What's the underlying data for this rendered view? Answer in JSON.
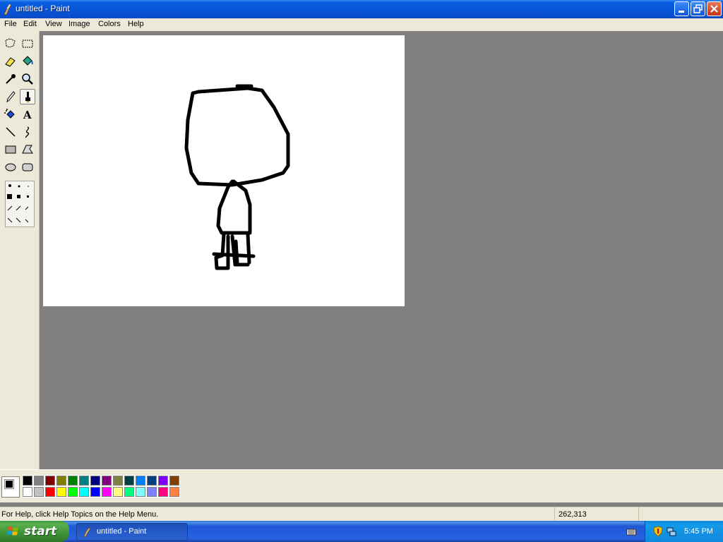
{
  "window": {
    "title": "untitled - Paint",
    "icon": "paint-brush-icon"
  },
  "menu": {
    "items": [
      "File",
      "Edit",
      "View",
      "Image",
      "Colors",
      "Help"
    ]
  },
  "toolbox": {
    "tools": [
      "free-form-select",
      "select",
      "eraser",
      "fill-with-color",
      "pick-color",
      "magnifier",
      "pencil",
      "brush",
      "airbrush",
      "text",
      "line",
      "curve",
      "rectangle",
      "polygon",
      "ellipse",
      "rounded-rectangle"
    ],
    "active_tool": "brush"
  },
  "colors": {
    "foreground": "#000000",
    "background": "#ffffff",
    "palette_top": [
      "#000000",
      "#808080",
      "#800000",
      "#808000",
      "#008000",
      "#008080",
      "#000080",
      "#800080",
      "#808040",
      "#004040",
      "#0080ff",
      "#004080",
      "#8000ff",
      "#804000"
    ],
    "palette_bottom": [
      "#ffffff",
      "#c0c0c0",
      "#ff0000",
      "#ffff00",
      "#00ff00",
      "#00ffff",
      "#0000ff",
      "#ff00ff",
      "#ffff80",
      "#00ff80",
      "#80ffff",
      "#8080ff",
      "#ff0080",
      "#ff8040"
    ]
  },
  "status": {
    "help_text": "For Help, click Help Topics on the Help Menu.",
    "coordinates": "262,313"
  },
  "taskbar": {
    "start_label": "start",
    "task_label": "untitled - Paint",
    "clock": "5:45 PM"
  }
}
